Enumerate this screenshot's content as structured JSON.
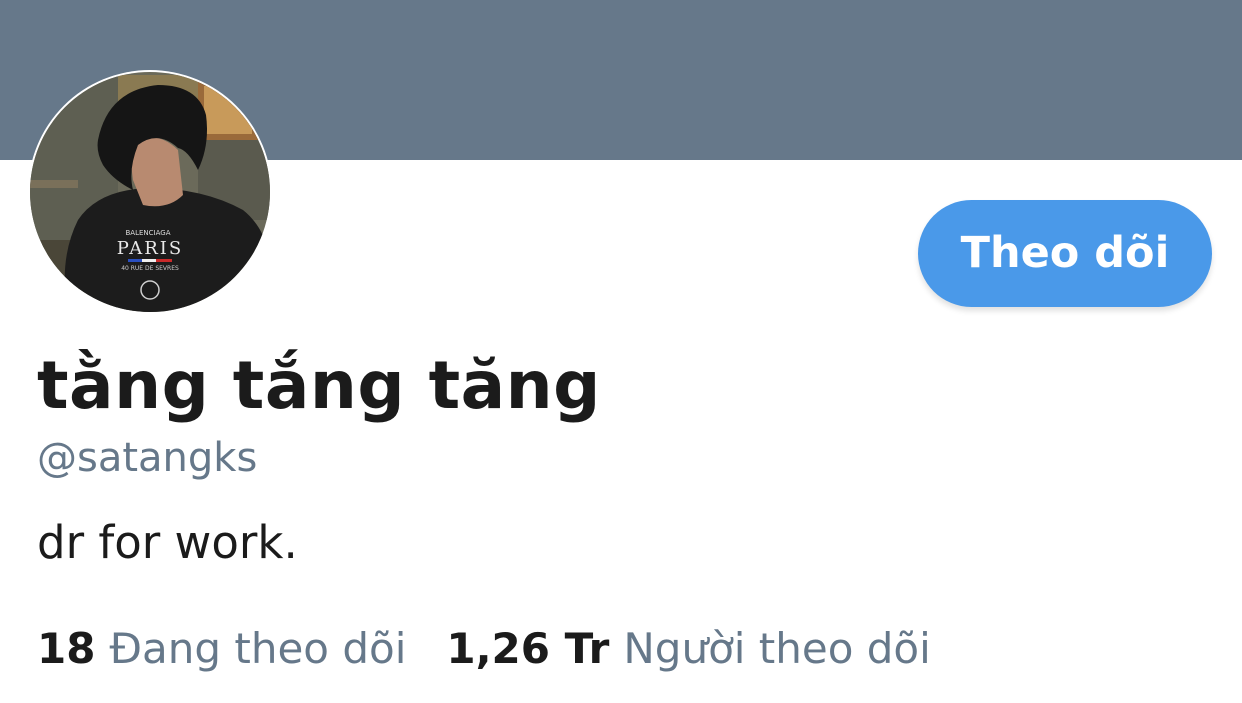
{
  "colors": {
    "banner": "#66788a",
    "accent": "#4a99e9",
    "muted": "#66788a",
    "text": "#1b1b1b"
  },
  "profile": {
    "display_name": "tằng tắng tăng",
    "handle": "@satangks",
    "bio": "dr for work."
  },
  "follow_button": {
    "label": "Theo dõi"
  },
  "stats": {
    "following_count": "18",
    "following_label": "Đang theo dõi",
    "followers_count": "1,26 Tr",
    "followers_label": "Người theo dõi"
  },
  "avatar": {
    "shirt_text": "PARIS"
  }
}
